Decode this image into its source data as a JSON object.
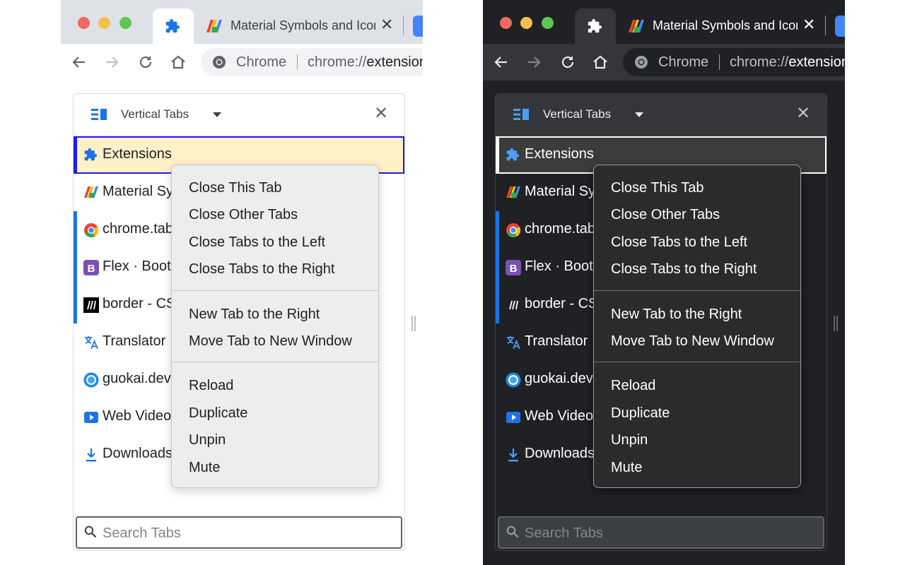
{
  "tab_strip": {
    "inactive_tab_title": "Material Symbols and Icons",
    "close_glyph": "✕"
  },
  "toolbar": {
    "omnibox_label": "Chrome",
    "url_prefix": "chrome://",
    "url_host": "extensions"
  },
  "panel": {
    "title": "Vertical Tabs",
    "close_glyph": "✕",
    "active_tab": {
      "title": "Extensions",
      "icon": "puzzle-icon"
    },
    "tabs": [
      {
        "title": "Material Symbols and Icons",
        "icon": "material-logo-icon",
        "pinned": false
      },
      {
        "title": "chrome.tabs",
        "icon": "chrome-logo-icon",
        "pinned": true
      },
      {
        "title": "Flex · Bootstrap",
        "icon": "bootstrap-icon",
        "pinned": true
      },
      {
        "title": "border - CSS",
        "icon": "mdn-icon",
        "pinned": true
      },
      {
        "title": "Translator",
        "icon": "translate-icon",
        "pinned": false
      },
      {
        "title": "guokai.dev",
        "icon": "guokai-icon",
        "pinned": false
      },
      {
        "title": "Web Video",
        "icon": "video-play-icon",
        "pinned": false
      },
      {
        "title": "Downloads",
        "icon": "download-icon",
        "pinned": false
      }
    ],
    "search_placeholder": "Search Tabs"
  },
  "context_menu": {
    "groups": [
      [
        "Close This Tab",
        "Close Other Tabs",
        "Close Tabs to the Left",
        "Close Tabs to the Right"
      ],
      [
        "New Tab to the Right",
        "Move Tab to New Window"
      ],
      [
        "Reload",
        "Duplicate",
        "Unpin",
        "Mute"
      ]
    ]
  },
  "themes": {
    "light": {
      "accent": "#1a73e8",
      "active_row_bg": "#fef0c7",
      "active_row_border": "#1a1aff"
    },
    "dark": {
      "accent": "#1a73e8",
      "active_row_bg": "#3c3c3c",
      "active_row_border": "#ffffff"
    }
  }
}
